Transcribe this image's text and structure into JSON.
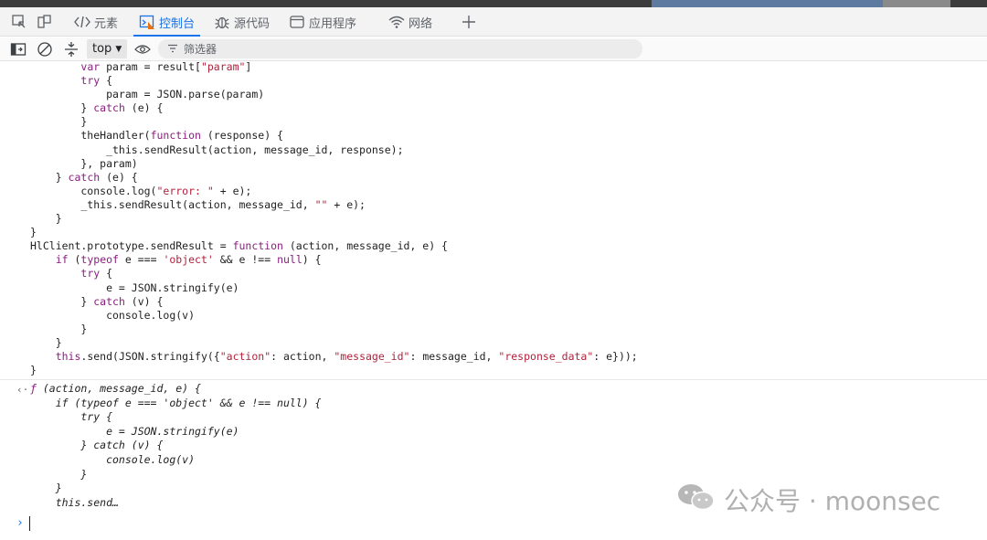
{
  "tabs": [
    {
      "label": "元素",
      "icon": "code-brackets-icon"
    },
    {
      "label": "控制台",
      "icon": "console-icon",
      "active": true
    },
    {
      "label": "源代码",
      "icon": "bug-icon"
    },
    {
      "label": "应用程序",
      "icon": "app-window-icon"
    },
    {
      "label": "网络",
      "icon": "wifi-icon"
    }
  ],
  "toolbar": {
    "context": "top",
    "filter_placeholder": "筛选器"
  },
  "source_lines": [
    "        var param = result[\"param\"]",
    "        try {",
    "            param = JSON.parse(param)",
    "        } catch (e) {",
    "        }",
    "        theHandler(function (response) {",
    "            _this.sendResult(action, message_id, response);",
    "        }, param)",
    "    } catch (e) {",
    "        console.log(\"error: \" + e);",
    "        _this.sendResult(action, message_id, \"\" + e);",
    "    }",
    "}",
    "HlClient.prototype.sendResult = function (action, message_id, e) {",
    "    if (typeof e === 'object' && e !== null) {",
    "        try {",
    "            e = JSON.stringify(e)",
    "        } catch (v) {",
    "            console.log(v)",
    "        }",
    "    }",
    "    this.send(JSON.stringify({\"action\": action, \"message_id\": message_id, \"response_data\": e}));",
    "}"
  ],
  "result": {
    "signature": " (action, message_id, e) {",
    "lines": [
      "    if (typeof e === 'object' && e !== null) {",
      "        try {",
      "            e = JSON.stringify(e)",
      "        } catch (v) {",
      "            console.log(v)",
      "        }",
      "    }",
      "    this.send…"
    ]
  },
  "watermark": "公众号 · moonsec"
}
